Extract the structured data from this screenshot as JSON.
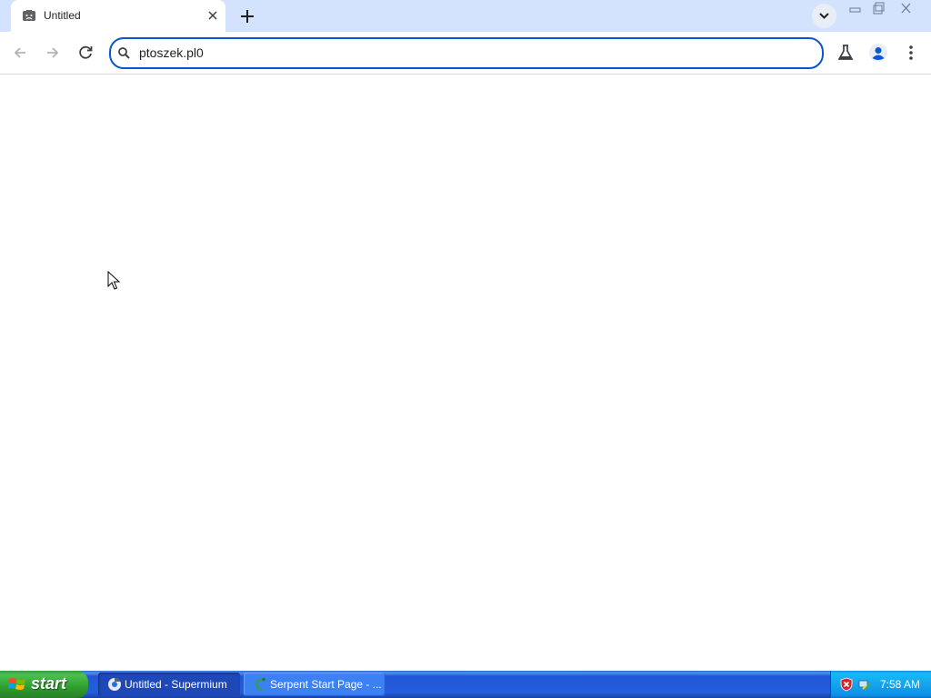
{
  "browser": {
    "tab": {
      "title": "Untitled"
    },
    "omnibox": {
      "value": "ptoszek.pl0"
    }
  },
  "taskbar": {
    "start_label": "start",
    "buttons": [
      {
        "label": "Untitled - Supermium",
        "state": "active"
      },
      {
        "label": "Serpent Start Page - ...",
        "state": "inactive"
      }
    ],
    "clock": "7:58 AM"
  },
  "colors": {
    "tabstrip": "#d3e3fd",
    "omnibox_focus": "#0b57d0",
    "profile_icon": "#0b57d0",
    "taskbar": "#245edb",
    "start_button": "#3c9a3c"
  }
}
